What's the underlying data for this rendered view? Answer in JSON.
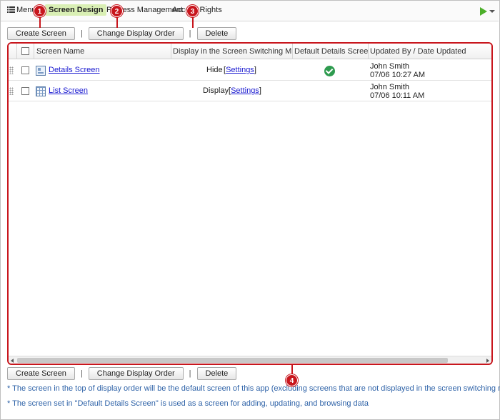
{
  "nav": {
    "menu_label": "Menu",
    "screen_design": "Screen Design",
    "process_management": "Process Management",
    "access_rights": "Access Rights"
  },
  "toolbar": {
    "create_screen": "Create Screen",
    "change_display_order": "Change Display Order",
    "delete": "Delete",
    "separator": "|"
  },
  "grid": {
    "columns": {
      "screen_name": "Screen Name",
      "display_in_switching": "Display in the Screen Switching M...",
      "default_details": "Default Details Screen",
      "updated": "Updated By / Date Updated"
    },
    "rows": [
      {
        "name": "Details Screen",
        "display": "Hide",
        "settings": "[Settings]",
        "settings_link": "Settings",
        "default": true,
        "updated_by": "John Smith",
        "updated_date": "07/06 10:27 AM"
      },
      {
        "name": "List Screen",
        "display": "Display",
        "settings": "[Settings]",
        "settings_link": "Settings",
        "default": false,
        "updated_by": "John Smith",
        "updated_date": "07/06 10:11 AM"
      }
    ]
  },
  "callouts": [
    "1",
    "2",
    "3",
    "4"
  ],
  "notes": [
    "* The screen in the top of display order will be the default screen of this app (excluding screens that are not displayed in the screen switching menu)",
    "* The screen set in \"Default Details Screen\" is used as a screen for adding, updating, and browsing data"
  ],
  "colors": {
    "accent": "#c8161d",
    "active_tab": "#d9efb4",
    "link": "#1a1ad0",
    "note": "#2f63a8",
    "check": "#2e9b4f"
  }
}
